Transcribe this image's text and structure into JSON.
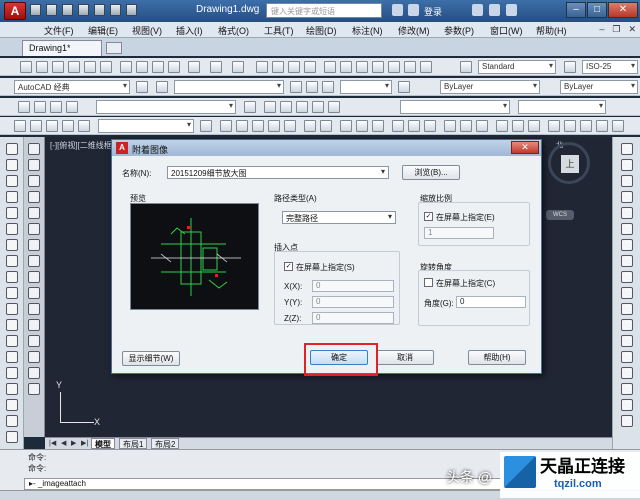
{
  "window": {
    "doc_title": "Drawing1.dwg",
    "search_placeholder": "键入关键字或短语",
    "login": "登录"
  },
  "menu": [
    "文件(F)",
    "编辑(E)",
    "视图(V)",
    "插入(I)",
    "格式(O)",
    "工具(T)",
    "绘图(D)",
    "标注(N)",
    "修改(M)",
    "参数(P)",
    "窗口(W)",
    "帮助(H)"
  ],
  "file_tab": "Drawing1*",
  "toolbars": {
    "workspace": "AutoCAD 经典",
    "text_style": "Standard",
    "dim_style": "ISO-25",
    "layer_prop": "ByLayer",
    "linetype": "ByLayer"
  },
  "viewport_label": "[-][俯视][二维线框]",
  "viewcube": {
    "face": "上",
    "north": "北",
    "wcs": "WCS"
  },
  "ucs": {
    "x": "X",
    "y": "Y"
  },
  "layout_tabs": [
    "模型",
    "布局1",
    "布局2"
  ],
  "command": {
    "history": [
      "命令:",
      "命令:"
    ],
    "input": "_imageattach"
  },
  "dialog": {
    "title": "附着图像",
    "name_label": "名称(N):",
    "name_value": "20151209细节放大图",
    "browse_button": "浏览(B)...",
    "preview_label": "预览",
    "path_type_label": "路径类型(A)",
    "path_type_value": "完整路径",
    "insertion_point_label": "插入点",
    "specify_onscreen_label": "在屏幕上指定(S)",
    "specify_onscreen_checked": true,
    "x_label": "X(X):",
    "y_label": "Y(Y):",
    "z_label": "Z(Z):",
    "x_value": "0",
    "y_value": "0",
    "z_value": "0",
    "scale_label": "缩放比例",
    "scale_onscreen_label": "在屏幕上指定(E)",
    "scale_onscreen_checked": true,
    "scale_value": "1",
    "rotation_label": "旋转角度",
    "rotation_onscreen_label": "在屏幕上指定(C)",
    "rotation_onscreen_checked": false,
    "angle_label": "角度(G):",
    "angle_value": "0",
    "show_details_button": "显示细节(W)",
    "ok_button": "确定",
    "cancel_button": "取消",
    "help_button": "帮助(H)"
  },
  "watermark": {
    "handle": "头条 @",
    "brand": "天晶正连接",
    "url": "tqzil.com"
  },
  "colors": {
    "title_bar": "#254e82",
    "highlight": "#e0212a",
    "canvas": "#202634"
  }
}
